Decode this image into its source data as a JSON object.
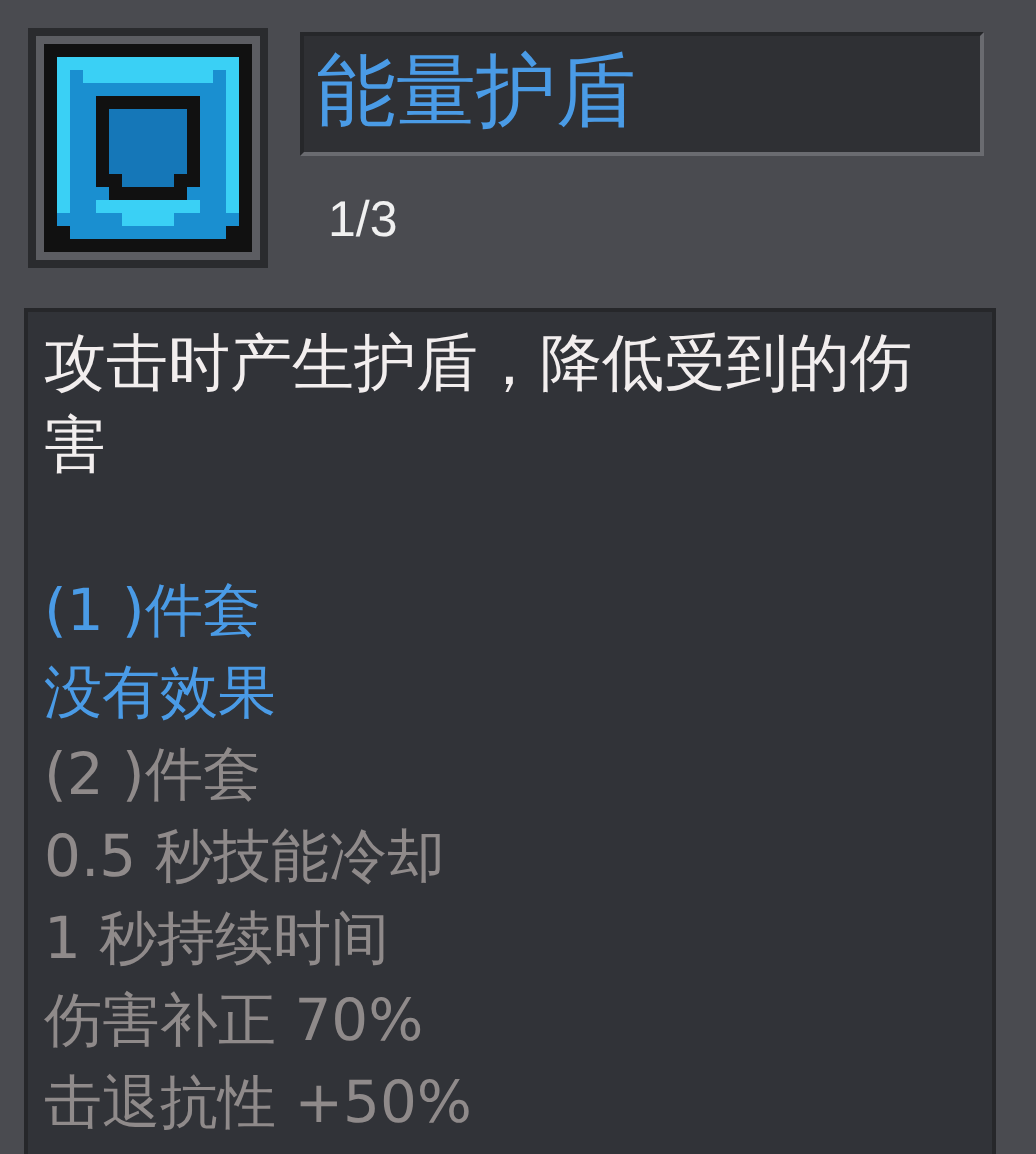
{
  "item": {
    "name": "能量护盾",
    "count": "1/3"
  },
  "description": "攻击时产生护盾，降低受到的伤害",
  "set_lines": [
    {
      "text": "(1 )件套",
      "active": true
    },
    {
      "text": "没有效果",
      "active": true
    },
    {
      "text": "(2 )件套",
      "active": false
    },
    {
      "text": "0.5 秒技能冷却",
      "active": false
    },
    {
      "text": "1 秒持续时间",
      "active": false
    },
    {
      "text": "伤害补正 70%",
      "active": false
    },
    {
      "text": "击退抗性 +50%",
      "active": false
    }
  ]
}
